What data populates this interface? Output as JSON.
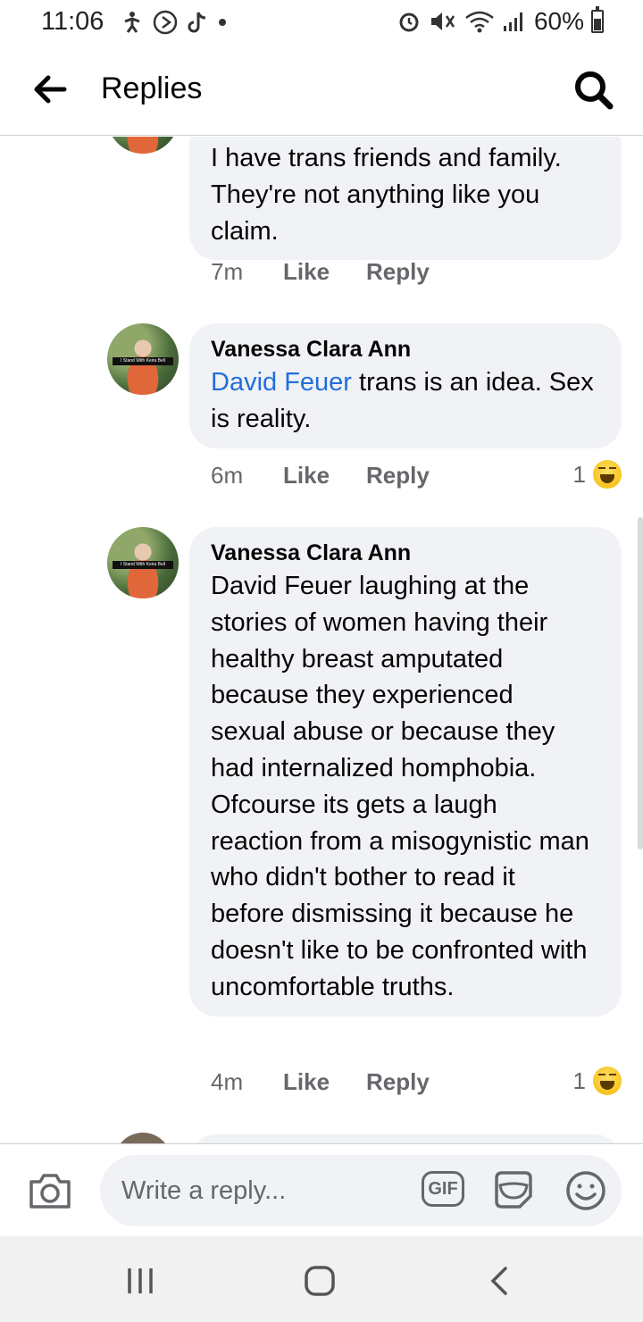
{
  "status_bar": {
    "time": "11:06",
    "battery": "60%",
    "battery_level": 0.6
  },
  "header": {
    "title": "Replies",
    "back_icon": "arrow-left-icon",
    "search_icon": "search-icon"
  },
  "comments": [
    {
      "author": "",
      "mention": "",
      "text": "I have trans friends and family. They're not anything like you claim.",
      "time": "7m",
      "like_label": "Like",
      "reply_label": "Reply",
      "reaction_count": ""
    },
    {
      "author": "Vanessa Clara Ann",
      "avatar_caption": "I Stand With Keira Bell",
      "mention": "David Feuer",
      "text": " trans is an idea. Sex is reality.",
      "time": "6m",
      "like_label": "Like",
      "reply_label": "Reply",
      "reaction_count": "1",
      "reaction_icon": "haha-emoji-icon"
    },
    {
      "author": "Vanessa Clara Ann",
      "avatar_caption": "I Stand With Keira Bell",
      "mention": "",
      "text": "David Feuer laughing at the stories of women having their healthy breast amputated because they experienced sexual abuse or because they had internalized homphobia. Ofcourse its gets a laugh reaction from a misogynistic man who didn't bother to read it before dismissing it because he doesn't like to be confronted with uncomfortable truths.",
      "time": "4m",
      "like_label": "Like",
      "reply_label": "Reply",
      "reaction_count": "1",
      "reaction_icon": "haha-emoji-icon"
    }
  ],
  "composer": {
    "placeholder": "Write a reply...",
    "gif_label": "GIF"
  },
  "colors": {
    "bubble": "#f0f2f5",
    "mention": "#216fdb",
    "secondary_text": "#65676b"
  }
}
